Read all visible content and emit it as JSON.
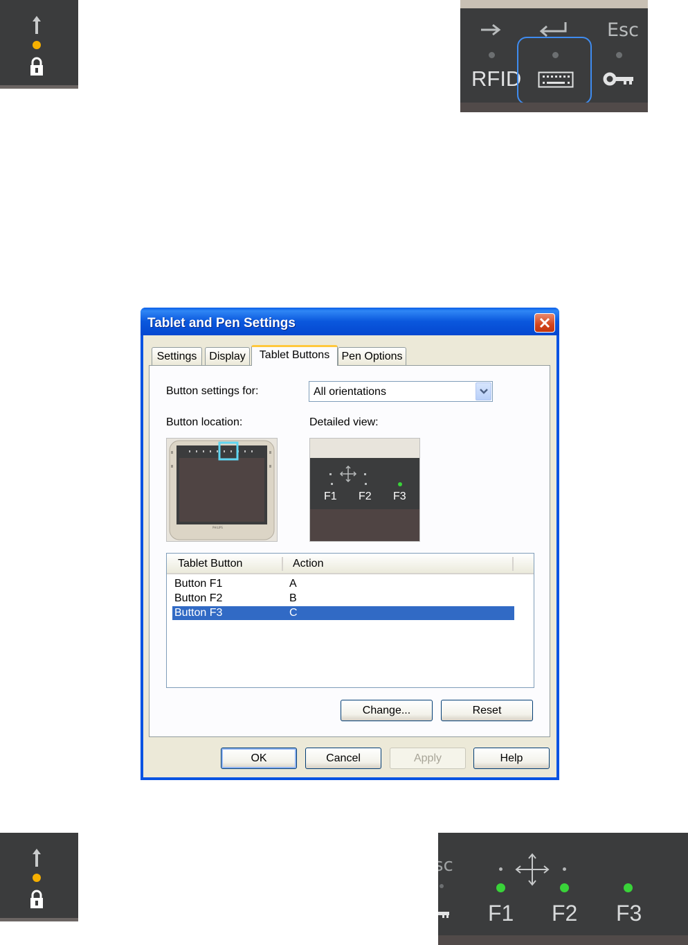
{
  "keyboard_panel": {
    "escape_label": "Esc",
    "rfid_label": "RFID",
    "colors": {
      "highlight": "#3f8cf0",
      "led_off": "#6c6f71"
    }
  },
  "function_keys_panel": {
    "partial_escape_label": "sc",
    "keys": [
      "F1",
      "F2",
      "F3"
    ],
    "colors": {
      "led_on": "#39d339"
    }
  },
  "lock_panel": {
    "colors": {
      "status_led": "#f6b000"
    }
  },
  "dialog": {
    "title": "Tablet and Pen Settings",
    "tabs": [
      {
        "label": "Settings"
      },
      {
        "label": "Display"
      },
      {
        "label": "Tablet Buttons",
        "active": true
      },
      {
        "label": "Pen Options"
      }
    ],
    "button_settings_label": "Button settings for:",
    "orientation_value": "All orientations",
    "button_location_label": "Button location:",
    "detailed_view_label": "Detailed view:",
    "detailed_view_keys": [
      "F1",
      "F2",
      "F3"
    ],
    "tablet_brand": "PHILIPS",
    "columns": {
      "button": "Tablet Button",
      "action": "Action"
    },
    "rows": [
      {
        "button": "Button F1",
        "action": "A",
        "selected": false
      },
      {
        "button": "Button F2",
        "action": "B",
        "selected": false
      },
      {
        "button": "Button F3",
        "action": "C",
        "selected": true
      }
    ],
    "change_label": "Change...",
    "reset_label": "Reset",
    "ok_label": "OK",
    "cancel_label": "Cancel",
    "apply_label": "Apply",
    "help_label": "Help",
    "colors": {
      "titlebar": "#0853e2",
      "selection": "#316ac5",
      "location_highlight": "#5fd6f2"
    }
  }
}
